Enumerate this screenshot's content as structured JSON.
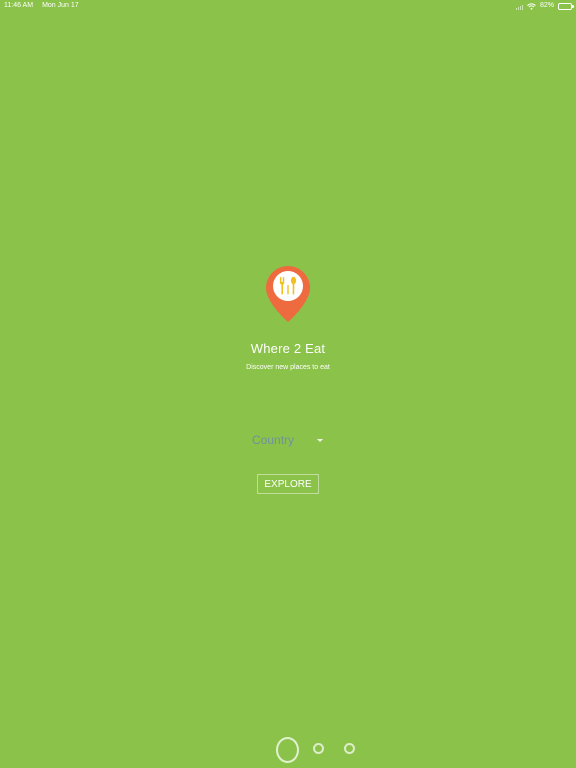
{
  "status_bar": {
    "time": "11:46 AM",
    "date": "Mon Jun 17",
    "battery_percent": "82%",
    "battery_level": 0.82,
    "icons": [
      "signal-icon",
      "wifi-icon",
      "battery-icon"
    ]
  },
  "colors": {
    "background": "#8bc34a",
    "logo_pin": "#ee6a3f",
    "logo_utensils": "#f2c01c"
  },
  "app": {
    "title": "Where 2 Eat",
    "subtitle": "Discover new places to eat",
    "logo_icon": "location-pin-utensils-icon"
  },
  "form": {
    "country_select": {
      "selected_value": "Country",
      "icon": "caret-down-icon"
    },
    "explore_label": "EXPLORE"
  },
  "pager": {
    "page_count": 3,
    "active_index": 0
  }
}
